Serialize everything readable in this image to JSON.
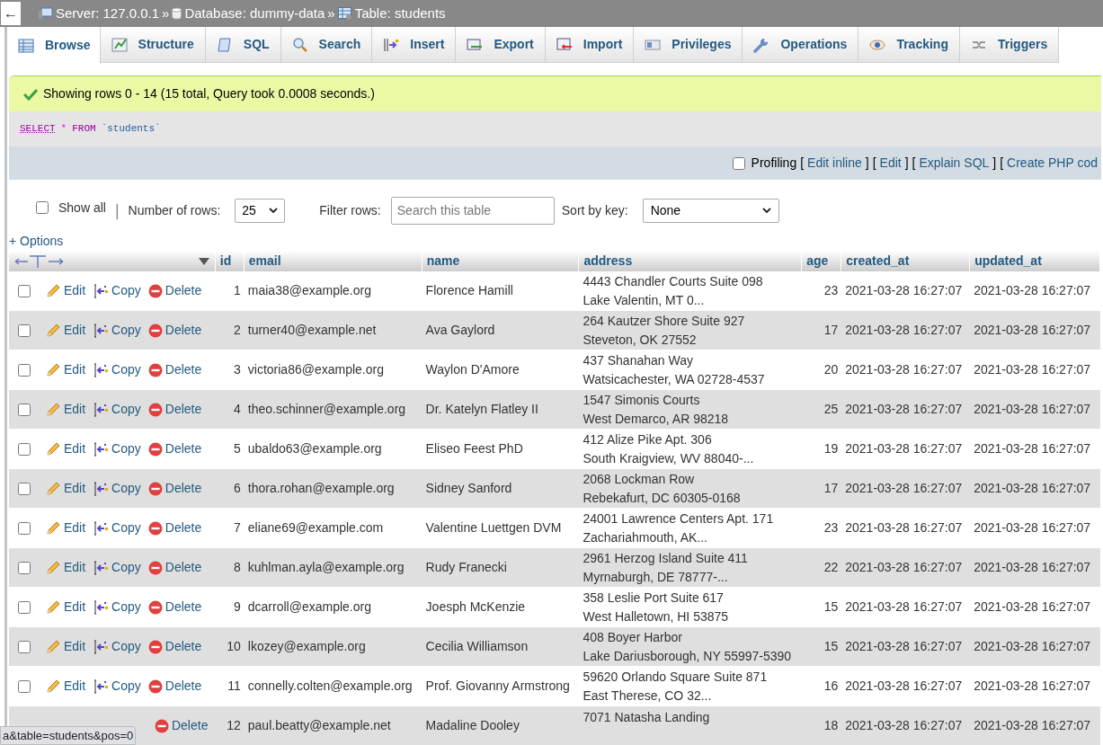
{
  "breadcrumb": {
    "back": "←",
    "items": [
      {
        "kind": "server",
        "label": "Server: 127.0.0.1"
      },
      {
        "kind": "database",
        "label": "Database: dummy-data"
      },
      {
        "kind": "table",
        "label": "Table: students"
      }
    ],
    "separator": "»"
  },
  "tabs": [
    {
      "kind": "browse",
      "label": "Browse",
      "selected": true
    },
    {
      "kind": "structure",
      "label": "Structure",
      "selected": false
    },
    {
      "kind": "sql",
      "label": "SQL",
      "selected": false
    },
    {
      "kind": "search",
      "label": "Search",
      "selected": false
    },
    {
      "kind": "insert",
      "label": "Insert",
      "selected": false
    },
    {
      "kind": "export",
      "label": "Export",
      "selected": false
    },
    {
      "kind": "import",
      "label": "Import",
      "selected": false
    },
    {
      "kind": "privileges",
      "label": "Privileges",
      "selected": false
    },
    {
      "kind": "operations",
      "label": "Operations",
      "selected": false
    },
    {
      "kind": "tracking",
      "label": "Tracking",
      "selected": false
    },
    {
      "kind": "triggers",
      "label": "Triggers",
      "selected": false
    }
  ],
  "message": "Showing rows 0 - 14 (15 total, Query took 0.0008 seconds.)",
  "sql": [
    {
      "kind": "keyword",
      "text": "SELECT"
    },
    {
      "kind": "operator",
      "text": "*"
    },
    {
      "kind": "keyword2",
      "text": "FROM"
    },
    {
      "kind": "identifier",
      "text": "`students`"
    }
  ],
  "profiling": {
    "checked": false,
    "label": "Profiling",
    "links": [
      {
        "before": "[",
        "label": "Edit inline",
        "after": "]"
      },
      {
        "before": "[",
        "label": "Edit",
        "after": "]"
      },
      {
        "before": "[",
        "label": "Explain SQL",
        "after": "]"
      },
      {
        "before": "[",
        "label": "Create PHP cod"
      }
    ]
  },
  "controls": {
    "show_all": {
      "label": "Show all",
      "checked": false
    },
    "separator": "|",
    "rows_label": "Number of rows:",
    "rows_value": "25",
    "filter_label": "Filter rows:",
    "filter_placeholder": "Search this table",
    "sort_label": "Sort by key:",
    "sort_value": "None"
  },
  "options": "+ Options",
  "table": {
    "columns": [
      "id",
      "email",
      "name",
      "address",
      "age",
      "created_at",
      "updated_at"
    ],
    "rows": [
      {
        "checkbox": {
          "checked": false
        },
        "actions": [
          "Edit",
          "Copy",
          "Delete"
        ],
        "cells": [
          "1",
          "maia38@example.org",
          "Florence Hamill",
          [
            "4443 Chandler Courts Suite 098",
            "Lake Valentin, MT 0..."
          ],
          "23",
          "2021-03-28 16:27:07",
          "2021-03-28 16:27:07"
        ]
      },
      {
        "checkbox": {
          "checked": false
        },
        "actions": [
          "Edit",
          "Copy",
          "Delete"
        ],
        "cells": [
          "2",
          "turner40@example.net",
          "Ava Gaylord",
          [
            "264 Kautzer Shore Suite 927",
            "Steveton, OK 27552"
          ],
          "17",
          "2021-03-28 16:27:07",
          "2021-03-28 16:27:07"
        ]
      },
      {
        "checkbox": {
          "checked": false
        },
        "actions": [
          "Edit",
          "Copy",
          "Delete"
        ],
        "cells": [
          "3",
          "victoria86@example.org",
          "Waylon D'Amore",
          [
            "437 Shanahan Way",
            "Watsicachester, WA 02728-4537"
          ],
          "20",
          "2021-03-28 16:27:07",
          "2021-03-28 16:27:07"
        ]
      },
      {
        "checkbox": {
          "checked": false
        },
        "actions": [
          "Edit",
          "Copy",
          "Delete"
        ],
        "cells": [
          "4",
          "theo.schinner@example.org",
          "Dr. Katelyn Flatley II",
          [
            "1547 Simonis Courts",
            "West Demarco, AR 98218"
          ],
          "25",
          "2021-03-28 16:27:07",
          "2021-03-28 16:27:07"
        ]
      },
      {
        "checkbox": {
          "checked": false
        },
        "actions": [
          "Edit",
          "Copy",
          "Delete"
        ],
        "cells": [
          "5",
          "ubaldo63@example.org",
          "Eliseo Feest PhD",
          [
            "412 Alize Pike Apt. 306",
            "South Kraigview, WV 88040-..."
          ],
          "19",
          "2021-03-28 16:27:07",
          "2021-03-28 16:27:07"
        ]
      },
      {
        "checkbox": {
          "checked": false
        },
        "actions": [
          "Edit",
          "Copy",
          "Delete"
        ],
        "cells": [
          "6",
          "thora.rohan@example.org",
          "Sidney Sanford",
          [
            "2068 Lockman Row",
            "Rebekafurt, DC 60305-0168"
          ],
          "17",
          "2021-03-28 16:27:07",
          "2021-03-28 16:27:07"
        ]
      },
      {
        "checkbox": {
          "checked": false
        },
        "actions": [
          "Edit",
          "Copy",
          "Delete"
        ],
        "cells": [
          "7",
          "eliane69@example.com",
          "Valentine Luettgen DVM",
          [
            "24001 Lawrence Centers Apt. 171",
            "Zachariahmouth, AK..."
          ],
          "23",
          "2021-03-28 16:27:07",
          "2021-03-28 16:27:07"
        ]
      },
      {
        "checkbox": {
          "checked": false
        },
        "actions": [
          "Edit",
          "Copy",
          "Delete"
        ],
        "cells": [
          "8",
          "kuhlman.ayla@example.org",
          "Rudy Franecki",
          [
            "2961 Herzog Island Suite 411",
            "Myrnaburgh, DE 78777-..."
          ],
          "22",
          "2021-03-28 16:27:07",
          "2021-03-28 16:27:07"
        ]
      },
      {
        "checkbox": {
          "checked": false
        },
        "actions": [
          "Edit",
          "Copy",
          "Delete"
        ],
        "cells": [
          "9",
          "dcarroll@example.org",
          "Joesph McKenzie",
          [
            "358 Leslie Port Suite 617",
            "West Halletown, HI 53875"
          ],
          "15",
          "2021-03-28 16:27:07",
          "2021-03-28 16:27:07"
        ]
      },
      {
        "checkbox": {
          "checked": false
        },
        "actions": [
          "Edit",
          "Copy",
          "Delete"
        ],
        "cells": [
          "10",
          "lkozey@example.org",
          "Cecilia Williamson",
          [
            "408 Boyer Harbor",
            "Lake Dariusborough, NY 55997-5390"
          ],
          "15",
          "2021-03-28 16:27:07",
          "2021-03-28 16:27:07"
        ]
      },
      {
        "checkbox": {
          "checked": false
        },
        "actions": [
          "Edit",
          "Copy",
          "Delete"
        ],
        "cells": [
          "11",
          "connelly.colten@example.org",
          "Prof. Giovanny Armstrong",
          [
            "59620 Orlando Square Suite 871",
            "East Therese, CO 32..."
          ],
          "16",
          "2021-03-28 16:27:07",
          "2021-03-28 16:27:07"
        ]
      },
      {
        "actions": [
          "Delete"
        ],
        "cells": [
          "12",
          "paul.beatty@example.net",
          "Madaline Dooley",
          [
            "7071 Natasha Landing"
          ],
          "18",
          "2021-03-28 16:27:07",
          "2021-03-28 16:27:07"
        ]
      }
    ]
  },
  "status_url": "a&table=students&pos=0"
}
